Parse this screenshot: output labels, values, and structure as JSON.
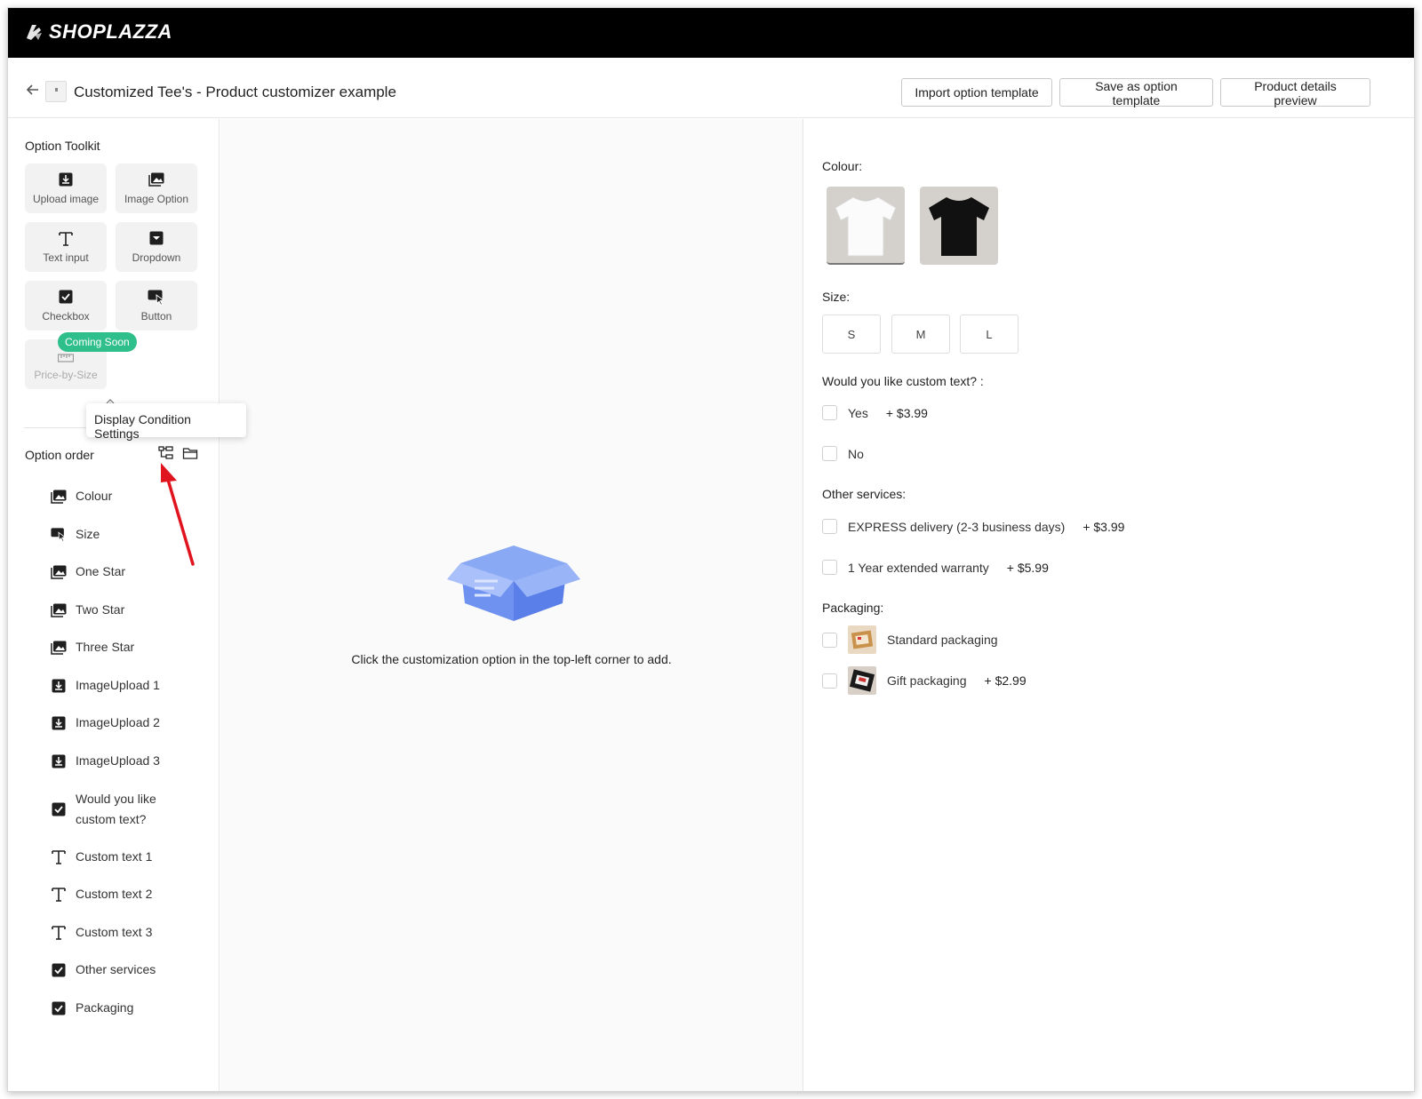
{
  "brand": {
    "name": "SHOPLAZZA"
  },
  "header": {
    "title": "Customized Tee's - Product customizer example",
    "buttons": {
      "import": "Import option template",
      "save": "Save as option template",
      "preview": "Product details preview"
    }
  },
  "toolkit": {
    "title": "Option Toolkit",
    "items": [
      {
        "label": "Upload image",
        "icon": "upload-icon"
      },
      {
        "label": "Image Option",
        "icon": "image-icon"
      },
      {
        "label": "Text input",
        "icon": "text-icon"
      },
      {
        "label": "Dropdown",
        "icon": "dropdown-icon"
      },
      {
        "label": "Checkbox",
        "icon": "checkbox-icon"
      },
      {
        "label": "Button",
        "icon": "cursor-icon"
      },
      {
        "label": "Price-by-Size",
        "icon": "ruler-icon"
      }
    ],
    "badge": "Coming Soon"
  },
  "tooltip": "Display Condition Settings",
  "option_order": {
    "title": "Option order",
    "items": [
      {
        "label": "Colour",
        "icon": "image-icon"
      },
      {
        "label": "Size",
        "icon": "cursor-icon"
      },
      {
        "label": "One Star",
        "icon": "image-icon"
      },
      {
        "label": "Two Star",
        "icon": "image-icon"
      },
      {
        "label": "Three Star",
        "icon": "image-icon"
      },
      {
        "label": "ImageUpload 1",
        "icon": "upload-icon"
      },
      {
        "label": "ImageUpload 2",
        "icon": "upload-icon"
      },
      {
        "label": "ImageUpload 3",
        "icon": "upload-icon"
      },
      {
        "label": "Would you like",
        "label2": "custom text?",
        "icon": "checkbox-icon"
      },
      {
        "label": "Custom text 1",
        "icon": "text-icon"
      },
      {
        "label": "Custom text 2",
        "icon": "text-icon"
      },
      {
        "label": "Custom text 3",
        "icon": "text-icon"
      },
      {
        "label": "Other services",
        "icon": "checkbox-icon"
      },
      {
        "label": "Packaging",
        "icon": "checkbox-icon"
      }
    ]
  },
  "center": {
    "empty_message": "Click the customization option in the top-left corner to add."
  },
  "preview": {
    "colour_label": "Colour:",
    "colours": [
      {
        "name": "white",
        "hex": "#ffffff"
      },
      {
        "name": "black",
        "hex": "#111111"
      }
    ],
    "size_label": "Size:",
    "sizes": [
      "S",
      "M",
      "L"
    ],
    "custom_text_label": "Would you like custom text? :",
    "custom_text_options": [
      {
        "label": "Yes",
        "price": "+ $3.99"
      },
      {
        "label": "No",
        "price": ""
      }
    ],
    "services_label": "Other services:",
    "services": [
      {
        "label": "EXPRESS delivery (2-3 business days)",
        "price": "+ $3.99"
      },
      {
        "label": "1 Year extended warranty",
        "price": "+ $5.99"
      }
    ],
    "packaging_label": "Packaging:",
    "packaging": [
      {
        "label": "Standard packaging",
        "price": ""
      },
      {
        "label": "Gift packaging",
        "price": "+ $2.99"
      }
    ]
  },
  "colors": {
    "topbar": "#000000",
    "badge": "#2fbf8a",
    "annotation_arrow": "#e0141e"
  }
}
